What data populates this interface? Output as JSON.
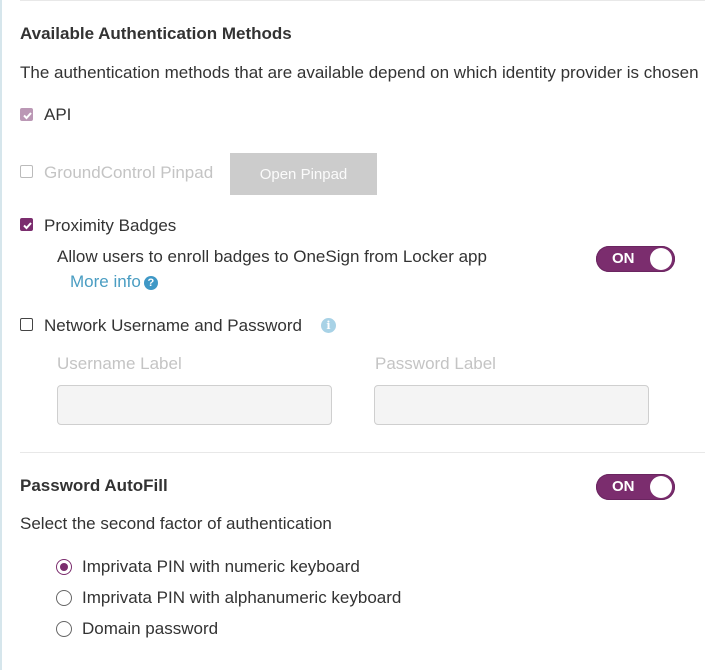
{
  "auth_methods": {
    "heading": "Available Authentication Methods",
    "description": "The authentication methods that are available depend on which identity provider is chosen",
    "api": {
      "label": "API",
      "checked": true,
      "disabled": true
    },
    "groundcontrol": {
      "label": "GroundControl Pinpad",
      "checked": false,
      "disabled": true,
      "button_label": "Open Pinpad"
    },
    "proximity": {
      "label": "Proximity Badges",
      "checked": true,
      "enroll_text": "Allow users to enroll badges to OneSign from Locker app",
      "more_info": "More info",
      "toggle_label": "ON"
    },
    "network": {
      "label": "Network Username and Password",
      "checked": false,
      "username_label": "Username Label",
      "username_value": "",
      "password_label": "Password Label",
      "password_value": ""
    }
  },
  "autofill": {
    "heading": "Password AutoFill",
    "toggle_label": "ON",
    "description": "Select the second factor of authentication",
    "options": [
      {
        "label": "Imprivata PIN with numeric keyboard",
        "selected": true
      },
      {
        "label": "Imprivata PIN with alphanumeric keyboard",
        "selected": false
      },
      {
        "label": "Domain password",
        "selected": false
      }
    ]
  },
  "colors": {
    "accent": "#7b2d6e",
    "link": "#4a9dc2"
  }
}
